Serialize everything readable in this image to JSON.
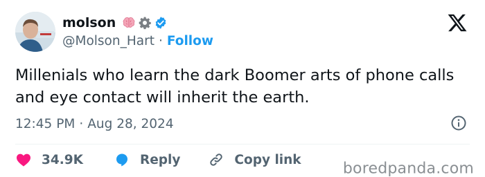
{
  "author": {
    "name": "molson",
    "handle": "@Molson_Hart",
    "separator": "·",
    "follow_label": "Follow",
    "avatar_icon": "person-photo-icon",
    "badges": [
      "brain-icon",
      "gear-icon",
      "verified-check-icon"
    ]
  },
  "platform": {
    "logo_icon": "x-logo-icon"
  },
  "tweet": {
    "text": "Millenials who learn the dark Boomer arts of phone calls and eye contact will inherit the earth.",
    "time": "12:45 PM",
    "separator": "·",
    "date": "Aug 28, 2024"
  },
  "actions": {
    "like_count": "34.9K",
    "reply_label": "Reply",
    "copy_link_label": "Copy link"
  },
  "watermark": "boredpanda.com",
  "colors": {
    "accent": "#1d9bf0",
    "like": "#f91880",
    "secondary_text": "#536471",
    "primary_text": "#0f1419"
  }
}
